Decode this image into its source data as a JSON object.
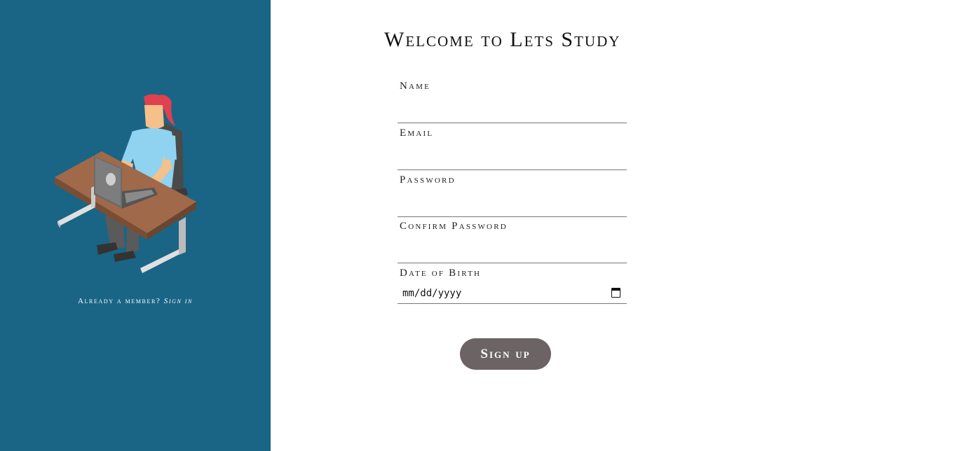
{
  "sidebar": {
    "prompt_text": "Already a member? ",
    "signin_link": "Sign in"
  },
  "form": {
    "title": "Welcome to Lets Study",
    "fields": [
      {
        "label": "Name",
        "value": ""
      },
      {
        "label": "Email",
        "value": ""
      },
      {
        "label": "Password",
        "value": ""
      },
      {
        "label": "Confirm Password",
        "value": ""
      },
      {
        "label": "Date of Birth",
        "placeholder": "mm/dd/yyyy"
      }
    ],
    "submit_label": "Sign up"
  },
  "colors": {
    "sidebar_bg": "#1a6585",
    "button_bg": "#6c6464",
    "hair": "#e04050",
    "shirt": "#8fd3f0",
    "skin": "#f5c08a",
    "desk_top": "#a0694a",
    "laptop": "#6b6b6b"
  }
}
